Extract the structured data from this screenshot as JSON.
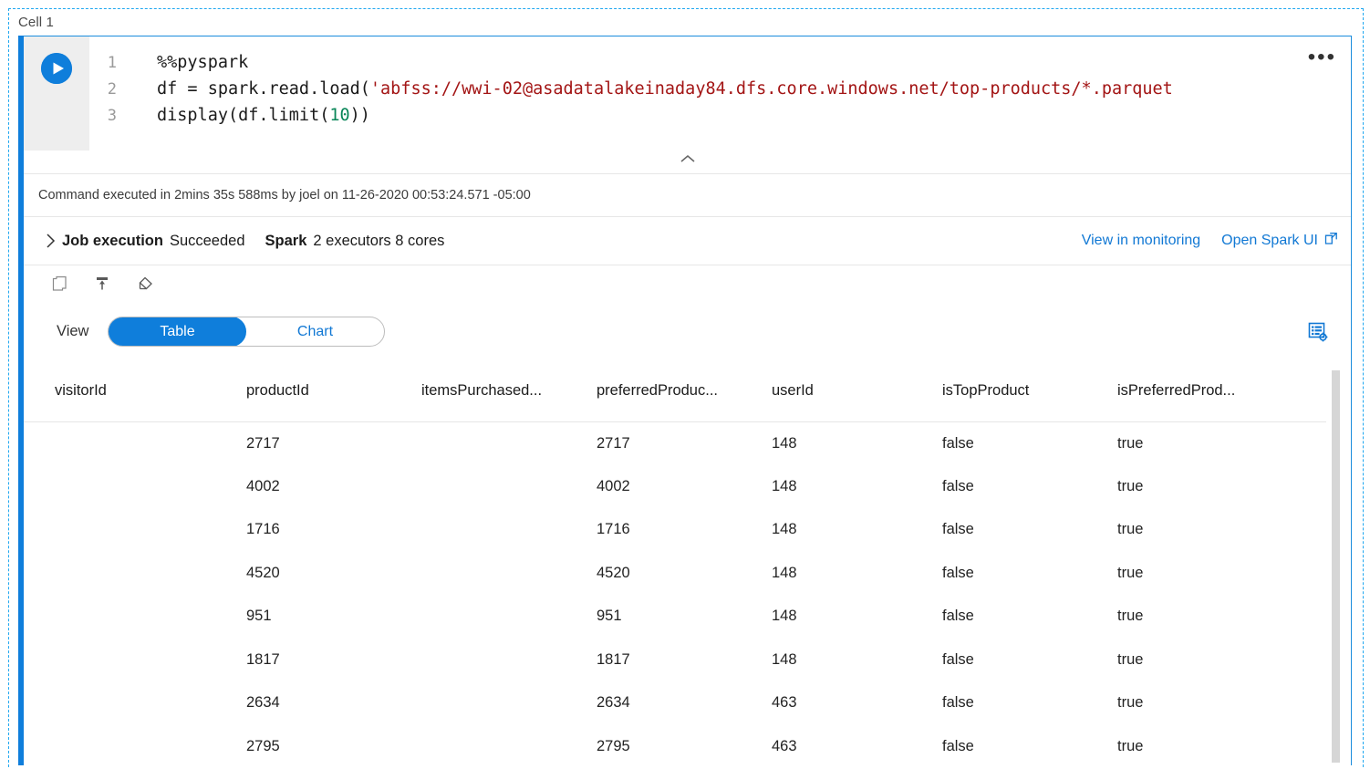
{
  "cell": {
    "label": "Cell 1",
    "run_button_title": "Run cell",
    "more_menu": "•••",
    "collapse_title": "Collapse"
  },
  "code": {
    "lines": [
      {
        "num": "1",
        "plain_before": "%%pyspark",
        "string": "",
        "plain_mid": "",
        "number": "",
        "plain_after": ""
      },
      {
        "num": "2",
        "plain_before": "df = spark.read.load(",
        "string": "'abfss://wwi-02@asadatalakeinaday84.dfs.core.windows.net/top-products/*.parquet",
        "plain_mid": "",
        "number": "",
        "plain_after": ""
      },
      {
        "num": "3",
        "plain_before": "display(df.limit(",
        "string": "",
        "plain_mid": "",
        "number": "10",
        "plain_after": "))"
      }
    ]
  },
  "status": {
    "command_executed": "Command executed in 2mins 35s 588ms by joel on 11-26-2020 00:53:24.571 -05:00"
  },
  "job": {
    "title": "Job execution",
    "state": "Succeeded",
    "engine": "Spark",
    "engine_detail": "2 executors 8 cores",
    "link_monitoring": "View in monitoring",
    "link_spark_ui": "Open Spark UI"
  },
  "actions": {
    "copy_label": "copy-icon",
    "export_label": "move-to-top-icon",
    "clear_label": "clear-output-icon"
  },
  "view": {
    "label": "View",
    "options": [
      {
        "label": "Table",
        "active": true
      },
      {
        "label": "Chart",
        "active": false
      }
    ],
    "settings_icon": "table-settings-icon"
  },
  "table_data": {
    "type": "table",
    "columns": [
      "visitorId",
      "productId",
      "itemsPurchased...",
      "preferredProduc...",
      "userId",
      "isTopProduct",
      "isPreferredProd..."
    ],
    "rows": [
      [
        "",
        "2717",
        "",
        "2717",
        "148",
        "false",
        "true"
      ],
      [
        "",
        "4002",
        "",
        "4002",
        "148",
        "false",
        "true"
      ],
      [
        "",
        "1716",
        "",
        "1716",
        "148",
        "false",
        "true"
      ],
      [
        "",
        "4520",
        "",
        "4520",
        "148",
        "false",
        "true"
      ],
      [
        "",
        "951",
        "",
        "951",
        "148",
        "false",
        "true"
      ],
      [
        "",
        "1817",
        "",
        "1817",
        "148",
        "false",
        "true"
      ],
      [
        "",
        "2634",
        "",
        "2634",
        "463",
        "false",
        "true"
      ],
      [
        "",
        "2795",
        "",
        "2795",
        "463",
        "false",
        "true"
      ]
    ]
  },
  "colors": {
    "accent_blue": "#0f7edb",
    "link_blue": "#1178d4",
    "selection_dashed": "#21a8f0",
    "string_red": "#a31515",
    "number_green": "#098658",
    "gutter_gray": "#eeeeee"
  }
}
